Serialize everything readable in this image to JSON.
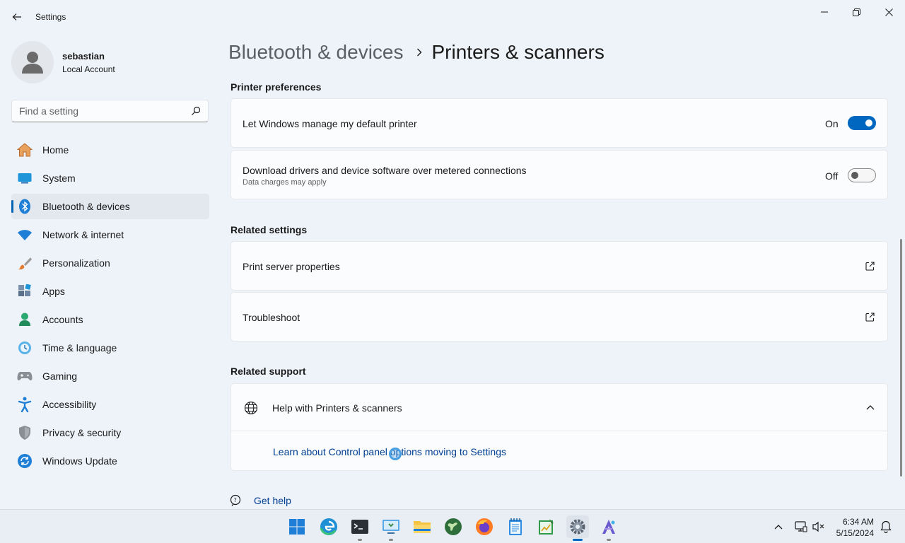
{
  "app": {
    "title": "Settings"
  },
  "profile": {
    "name": "sebastian",
    "account": "Local Account"
  },
  "search": {
    "placeholder": "Find a setting"
  },
  "sidebar": {
    "items": [
      {
        "label": "Home",
        "icon": "home-icon"
      },
      {
        "label": "System",
        "icon": "system-icon"
      },
      {
        "label": "Bluetooth & devices",
        "icon": "bluetooth-icon",
        "active": true
      },
      {
        "label": "Network & internet",
        "icon": "wifi-icon"
      },
      {
        "label": "Personalization",
        "icon": "brush-icon"
      },
      {
        "label": "Apps",
        "icon": "apps-icon"
      },
      {
        "label": "Accounts",
        "icon": "accounts-icon"
      },
      {
        "label": "Time & language",
        "icon": "clock-globe-icon"
      },
      {
        "label": "Gaming",
        "icon": "gamepad-icon"
      },
      {
        "label": "Accessibility",
        "icon": "accessibility-icon"
      },
      {
        "label": "Privacy & security",
        "icon": "shield-icon"
      },
      {
        "label": "Windows Update",
        "icon": "update-icon"
      }
    ]
  },
  "breadcrumb": {
    "parent": "Bluetooth & devices",
    "current": "Printers & scanners"
  },
  "printer_prefs": {
    "title": "Printer preferences",
    "manage_default": {
      "label": "Let Windows manage my default printer",
      "state": "On"
    },
    "metered": {
      "label": "Download drivers and device software over metered connections",
      "sub": "Data charges may apply",
      "state": "Off"
    }
  },
  "related_settings": {
    "title": "Related settings",
    "print_server": "Print server properties",
    "troubleshoot": "Troubleshoot"
  },
  "related_support": {
    "title": "Related support",
    "help_title": "Help with Printers & scanners",
    "link": "Learn about Control panel options moving to Settings"
  },
  "get_help": "Get help",
  "taskbar": {
    "time": "6:34 AM",
    "date": "5/15/2024",
    "apps": [
      "start-icon",
      "edge-icon",
      "terminal-icon",
      "remote-desktop-icon",
      "file-explorer-icon",
      "globe-app-icon",
      "firefox-icon",
      "notepad-icon",
      "spreadsheet-icon",
      "settings-icon",
      "paint-icon"
    ]
  },
  "colors": {
    "accent": "#0067c0",
    "link": "#003e92"
  }
}
